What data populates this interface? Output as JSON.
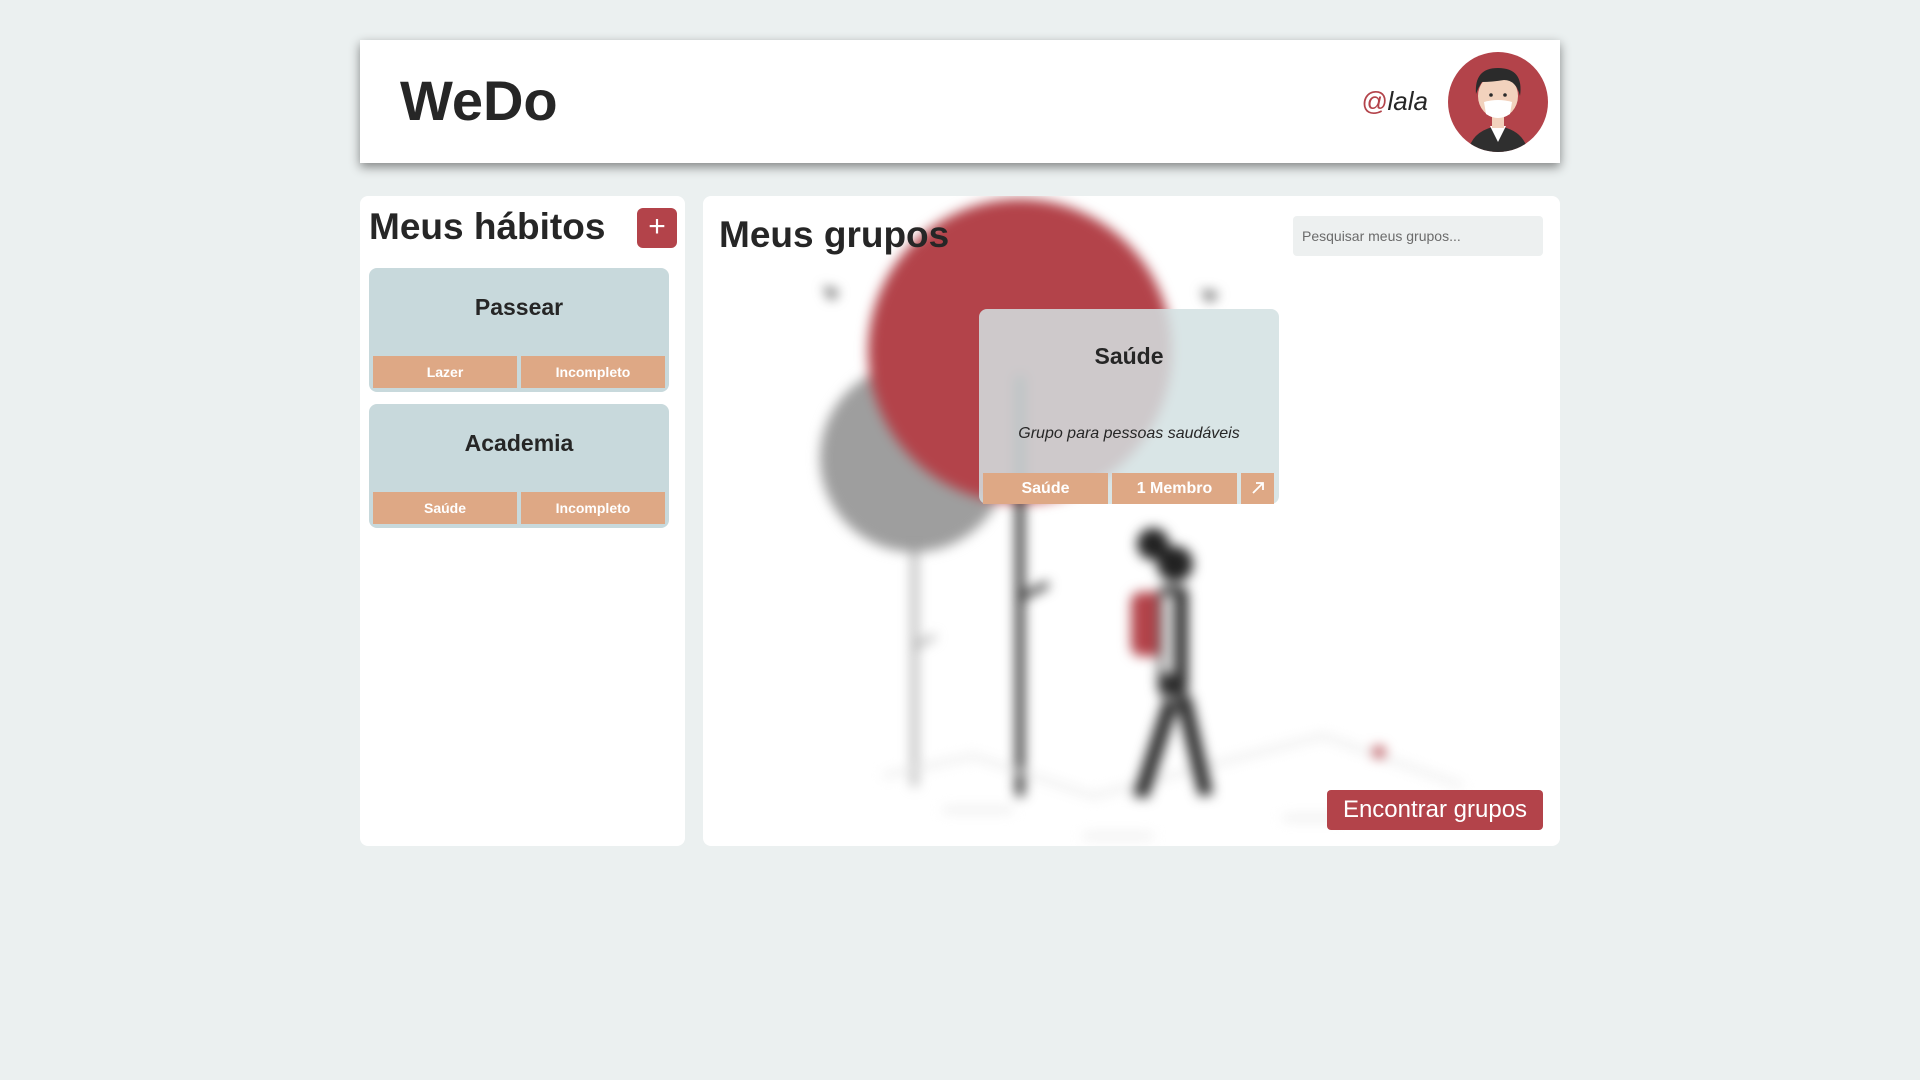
{
  "header": {
    "app_title": "WeDo",
    "username_at": "@",
    "username": "lala"
  },
  "habits": {
    "title": "Meus hábitos",
    "add_label": "+",
    "items": [
      {
        "name": "Passear",
        "category": "Lazer",
        "status": "Incompleto"
      },
      {
        "name": "Academia",
        "category": "Saúde",
        "status": "Incompleto"
      }
    ]
  },
  "groups": {
    "title": "Meus grupos",
    "search_placeholder": "Pesquisar meus grupos...",
    "items": [
      {
        "name": "Saúde",
        "description": "Grupo para pessoas saudáveis",
        "category": "Saúde",
        "members": "1 Membro"
      }
    ],
    "find_button": "Encontrar grupos"
  },
  "colors": {
    "accent": "#b3434a",
    "card_bg": "#c8d9dc",
    "tag_bg": "#dea885",
    "page_bg": "#ebf0f0"
  },
  "icons": {
    "add": "plus-icon",
    "open_group": "arrow-up-right-icon",
    "avatar": "user-avatar-illustration"
  }
}
